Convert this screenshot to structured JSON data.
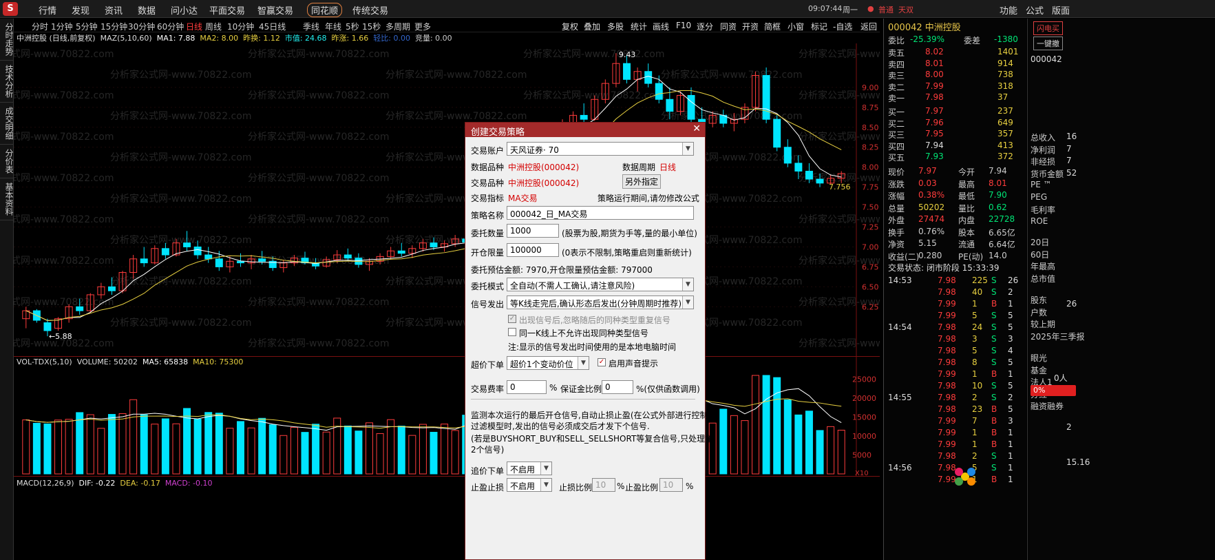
{
  "menu": {
    "items": [
      "行情",
      "发现",
      "资讯",
      "数据",
      "问小达",
      "平面交易",
      "智赢交易",
      "同花顺",
      "传统交易"
    ],
    "time": "09:07:44",
    "weekday": "周一",
    "user": "普通",
    "user2": "天双",
    "right_items": [
      "功能",
      "公式",
      "版面"
    ]
  },
  "sidetabs": [
    "分时走势",
    "技术分析",
    "成交明细",
    "分价表",
    "基本资料"
  ],
  "periods": [
    "分时",
    "1分钟",
    "5分钟",
    "15分钟",
    "30分钟",
    "60分钟",
    "日线",
    "周线",
    "10分钟",
    "45日线",
    "季线",
    "年线",
    "5秒",
    "15秒",
    "多周期",
    "更多"
  ],
  "toolbar": [
    "复权",
    "叠加",
    "多股",
    "统计",
    "画线",
    "F10",
    "逐分",
    "同资",
    "开资",
    "简框",
    "小窗",
    "标记",
    "-自选",
    "返回"
  ],
  "info": {
    "stock": "中洲控股 (日线,前复权)",
    "ma_label": "MAZ(5,10,60)",
    "ma1": "MA1: 7.88",
    "ma2": "MA2: 8.00",
    "change": "昨换: 1.12",
    "mcap": "市值: 24.68",
    "chg2": "昨涨: 1.66",
    "turn": "轻比: 0.00",
    "amount": "竞量: 0.00"
  },
  "price_axis": [
    "9.00",
    "8.75",
    "8.50",
    "8.25",
    "8.00",
    "7.75",
    "7.50",
    "7.25",
    "7.00",
    "6.75",
    "6.50",
    "6.25"
  ],
  "annotations": {
    "high": "9.43",
    "low": "5.88",
    "last": "7.756"
  },
  "vol": {
    "label": "VOL-TDX(5,10)",
    "volume": "VOLUME: 50202",
    "ma5": "MA5: 65838",
    "ma10": "MA10: 75300",
    "axis": [
      "25000",
      "20000",
      "15000",
      "10000",
      "5000"
    ],
    "scale": "X10"
  },
  "macd": {
    "label": "MACD(12,26,9)",
    "dif": "DIF: -0.22",
    "dea": "DEA: -0.17",
    "macd": "MACD: -0.10"
  },
  "watermark": "分析家公式网-www.70822.com",
  "quote": {
    "title": "000042 中洲控股",
    "webi": "委比",
    "webi_val": "-25.39%",
    "wecha": "委差",
    "wecha_val": "-1380",
    "asks": [
      {
        "l": "卖五",
        "p": "8.02",
        "v": "1401"
      },
      {
        "l": "卖四",
        "p": "8.01",
        "v": "914"
      },
      {
        "l": "卖三",
        "p": "8.00",
        "v": "738"
      },
      {
        "l": "卖二",
        "p": "7.99",
        "v": "318"
      },
      {
        "l": "卖一",
        "p": "7.98",
        "v": "37"
      }
    ],
    "bids": [
      {
        "l": "买一",
        "p": "7.97",
        "v": "237"
      },
      {
        "l": "买二",
        "p": "7.96",
        "v": "649"
      },
      {
        "l": "买三",
        "p": "7.95",
        "v": "357"
      },
      {
        "l": "买四",
        "p": "7.94",
        "v": "413"
      },
      {
        "l": "买五",
        "p": "7.93",
        "v": "372"
      }
    ],
    "stats": [
      [
        "现价",
        "7.97",
        "今开",
        "7.94"
      ],
      [
        "涨跌",
        "0.03",
        "最高",
        "8.01"
      ],
      [
        "涨幅",
        "0.38%",
        "最低",
        "7.90"
      ],
      [
        "总量",
        "50202",
        "量比",
        "0.62"
      ],
      [
        "外盘",
        "27474",
        "内盘",
        "22728"
      ],
      [
        "换手",
        "0.76%",
        "股本",
        "6.65亿"
      ],
      [
        "净资",
        "5.15",
        "流通",
        "6.64亿"
      ],
      [
        "收益(二)",
        "0.280",
        "PE(动)",
        "14.0"
      ]
    ],
    "status": "交易状态: 闭市阶段 15:33:39",
    "ticks": [
      [
        "14:53",
        "7.98",
        "225",
        "S",
        "26"
      ],
      [
        "",
        "7.98",
        "40",
        "S",
        "2"
      ],
      [
        "",
        "7.99",
        "1",
        "B",
        "1"
      ],
      [
        "",
        "7.99",
        "5",
        "S",
        "5"
      ],
      [
        "14:54",
        "7.98",
        "24",
        "S",
        "5"
      ],
      [
        "",
        "7.98",
        "3",
        "S",
        "3"
      ],
      [
        "",
        "7.98",
        "5",
        "S",
        "4"
      ],
      [
        "",
        "7.98",
        "8",
        "S",
        "5"
      ],
      [
        "",
        "7.99",
        "1",
        "B",
        "1"
      ],
      [
        "",
        "7.98",
        "10",
        "S",
        "5"
      ],
      [
        "14:55",
        "7.98",
        "2",
        "S",
        "2"
      ],
      [
        "",
        "7.98",
        "23",
        "B",
        "5"
      ],
      [
        "",
        "7.99",
        "7",
        "B",
        "3"
      ],
      [
        "",
        "7.99",
        "1",
        "B",
        "1"
      ],
      [
        "",
        "7.99",
        "1",
        "B",
        "1"
      ],
      [
        "",
        "7.98",
        "2",
        "S",
        "1"
      ],
      [
        "14:56",
        "7.98",
        "5",
        "S",
        "1"
      ],
      [
        "",
        "7.99",
        "1",
        "B",
        "1"
      ]
    ]
  },
  "farright": {
    "btn1": "闪电买",
    "btn2": "一键撤",
    "code": "000042",
    "labels": [
      "总收入",
      "净利润",
      "非经损",
      "货币金额",
      "PE ™",
      "PEG",
      "毛利率",
      "ROE",
      "20日",
      "60日",
      "年最高",
      "总市值",
      "股东",
      "户数",
      "较上期",
      "2025年三季报",
      "眼光",
      "基金",
      "法人1",
      "分红",
      "融资融券"
    ],
    "pct": "0%",
    "people": "0人",
    "right_vals": [
      "16",
      "7",
      "7",
      "52",
      "26",
      "2",
      "15.16"
    ]
  },
  "dialog": {
    "title": "创建交易策略",
    "account_label": "交易账户",
    "account": "天风证券·                     70",
    "data_label": "数据品种",
    "data_val": "中洲控股(000042)",
    "period_label": "数据周期",
    "period_val": "日线",
    "trade_label": "交易品种",
    "trade_val": "中洲控股(000042)",
    "other_btn": "另外指定",
    "index_label": "交易指标",
    "index_val": "MA交易",
    "index_note": "策略运行期间,请勿修改公式",
    "name_label": "策略名称",
    "name_val": "000042_日_MA交易",
    "qty_label": "委托数量",
    "qty_val": "1000",
    "qty_note": "(股票为股,期货为手等,量的最小单位)",
    "limit_label": "开仓限量",
    "limit_val": "100000",
    "limit_note": "(0表示不限制,策略重启则重新统计)",
    "est": "委托预估金额: 7970,开仓限量预估金额: 797000",
    "mode_label": "委托模式",
    "mode_val": "全自动(不需人工确认,请注意风险)",
    "signal_label": "信号发出",
    "signal_val": "等K线走完后,确认形态后发出(分钟周期时推荐)",
    "cb1": "出现信号后,忽略随后的同种类型重复信号",
    "cb2": "同一K线上不允许出现同种类型信号",
    "note": "注:显示的信号发出时间使用的是本地电脑时间",
    "over_label": "超价下单",
    "over_val": "超价1个变动价位",
    "sound": "启用声音提示",
    "fee_label": "交易费率",
    "fee_val": "0",
    "pct": "%",
    "margin_label": "保证金比例",
    "margin_val": "0",
    "margin_note": "%(仅供函数调用)",
    "desc": [
      "监测本次运行的最后开仓信号,自动止损止盈(在公式外部进行控制)",
      "过滤模型时,发出的信号必须成交后才发下个信号.",
      "(若是BUYSHORT_BUY和SELL_SELLSHORT等复合信号,只处理第",
      "2个信号)"
    ],
    "chase_label": "追价下单",
    "chase_val": "不启用",
    "stop_label": "止盈止损",
    "stop_val": "不启用",
    "sl_label": "止损比例",
    "sl_val": "10",
    "tp_label": "止盈比例",
    "tp_val": "10"
  },
  "colors": {
    "up": "#ff3c3c",
    "down": "#00e5ff",
    "ma1": "#ffffff",
    "ma2": "#e8d040"
  },
  "chart_data": {
    "type": "candlestick",
    "ylim": [
      5.7,
      9.5
    ],
    "candles": [
      [
        6.1,
        6.25,
        5.98,
        6.2
      ],
      [
        6.2,
        6.22,
        6.05,
        6.08
      ],
      [
        6.05,
        6.1,
        5.88,
        5.95
      ],
      [
        5.98,
        6.12,
        5.95,
        6.1
      ],
      [
        6.1,
        6.28,
        6.05,
        6.25
      ],
      [
        6.25,
        6.35,
        6.15,
        6.2
      ],
      [
        6.2,
        6.42,
        6.18,
        6.4
      ],
      [
        6.4,
        6.55,
        6.35,
        6.5
      ],
      [
        6.5,
        6.62,
        6.4,
        6.45
      ],
      [
        6.45,
        6.7,
        6.42,
        6.68
      ],
      [
        6.68,
        6.9,
        6.6,
        6.85
      ],
      [
        6.85,
        7.0,
        6.75,
        6.8
      ],
      [
        6.8,
        7.02,
        6.78,
        6.98
      ],
      [
        6.98,
        7.05,
        6.85,
        6.9
      ],
      [
        6.9,
        7.1,
        6.88,
        7.05
      ],
      [
        7.05,
        7.2,
        6.95,
        7.0
      ],
      [
        7.0,
        7.08,
        6.85,
        6.9
      ],
      [
        6.9,
        7.0,
        6.8,
        6.85
      ],
      [
        6.85,
        6.95,
        6.7,
        6.75
      ],
      [
        6.75,
        6.88,
        6.68,
        6.82
      ],
      [
        6.82,
        6.92,
        6.75,
        6.8
      ],
      [
        6.8,
        6.9,
        6.72,
        6.85
      ],
      [
        6.85,
        6.95,
        6.78,
        6.82
      ],
      [
        6.82,
        6.88,
        6.7,
        6.74
      ],
      [
        6.74,
        6.84,
        6.68,
        6.8
      ],
      [
        6.8,
        6.9,
        6.76,
        6.86
      ],
      [
        6.86,
        6.94,
        6.78,
        6.8
      ],
      [
        6.8,
        6.86,
        6.72,
        6.76
      ],
      [
        6.76,
        6.88,
        6.74,
        6.84
      ],
      [
        6.84,
        6.96,
        6.8,
        6.9
      ],
      [
        6.9,
        6.98,
        6.82,
        6.86
      ],
      [
        6.86,
        6.92,
        6.74,
        6.78
      ],
      [
        6.78,
        6.86,
        6.7,
        6.82
      ],
      [
        6.82,
        6.92,
        6.78,
        6.88
      ],
      [
        6.88,
        7.0,
        6.84,
        6.95
      ],
      [
        6.95,
        7.05,
        6.88,
        6.92
      ],
      [
        6.92,
        7.02,
        6.86,
        6.98
      ],
      [
        6.98,
        7.1,
        6.94,
        7.05
      ],
      [
        7.05,
        7.12,
        6.96,
        7.0
      ],
      [
        7.0,
        7.08,
        6.94,
        7.04
      ],
      [
        7.04,
        7.15,
        7.0,
        7.1
      ],
      [
        7.1,
        7.2,
        7.02,
        7.06
      ],
      [
        7.06,
        7.14,
        7.0,
        7.1
      ],
      [
        7.1,
        7.3,
        7.08,
        7.28
      ],
      [
        7.28,
        7.6,
        7.25,
        7.55
      ],
      [
        7.55,
        7.9,
        7.5,
        7.85
      ],
      [
        7.85,
        8.1,
        7.8,
        8.05
      ],
      [
        8.05,
        8.3,
        7.98,
        8.25
      ],
      [
        8.25,
        8.45,
        8.15,
        8.4
      ],
      [
        8.4,
        8.55,
        8.3,
        8.35
      ],
      [
        8.35,
        8.6,
        8.3,
        8.55
      ],
      [
        8.55,
        8.7,
        8.45,
        8.65
      ],
      [
        8.65,
        8.8,
        8.55,
        8.6
      ],
      [
        8.6,
        8.9,
        8.58,
        8.85
      ],
      [
        8.85,
        9.1,
        8.8,
        9.05
      ],
      [
        9.05,
        9.43,
        9.0,
        9.3
      ],
      [
        9.3,
        9.4,
        9.05,
        9.1
      ],
      [
        9.1,
        9.25,
        8.95,
        9.2
      ],
      [
        9.2,
        9.3,
        9.0,
        9.05
      ],
      [
        9.05,
        9.15,
        8.8,
        8.85
      ],
      [
        8.85,
        9.0,
        8.6,
        8.7
      ],
      [
        8.7,
        8.95,
        8.65,
        8.9
      ],
      [
        8.9,
        9.0,
        8.55,
        8.6
      ],
      [
        8.6,
        8.75,
        8.45,
        8.55
      ],
      [
        8.55,
        8.7,
        8.5,
        8.65
      ],
      [
        8.65,
        8.72,
        8.5,
        8.55
      ],
      [
        8.55,
        8.68,
        8.45,
        8.6
      ],
      [
        8.6,
        8.8,
        8.55,
        8.75
      ],
      [
        8.75,
        9.2,
        8.7,
        9.15
      ],
      [
        9.15,
        9.25,
        8.55,
        8.6
      ],
      [
        8.6,
        8.65,
        8.2,
        8.25
      ],
      [
        8.25,
        8.35,
        8.0,
        8.05
      ],
      [
        8.05,
        8.15,
        7.85,
        7.95
      ],
      [
        7.95,
        8.05,
        7.8,
        7.85
      ],
      [
        7.85,
        7.92,
        7.75,
        7.8
      ],
      [
        7.8,
        7.9,
        7.78,
        7.86
      ],
      [
        7.86,
        7.95,
        7.8,
        7.92
      ]
    ]
  }
}
